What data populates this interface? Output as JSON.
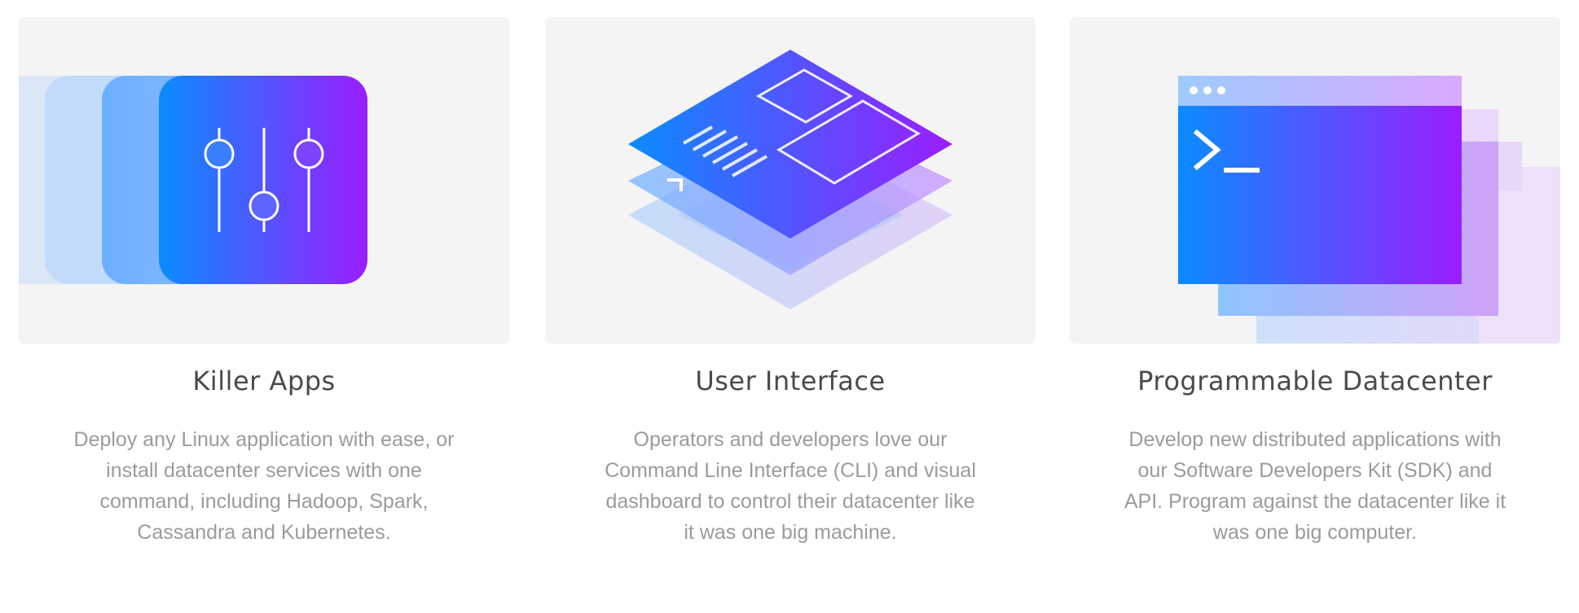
{
  "features": [
    {
      "title": "Killer Apps",
      "icon": "sliders-icon",
      "description": [
        "Deploy any Linux application with ease, or",
        "install datacenter services with one",
        "command, including Hadoop, Spark,",
        "Cassandra and Kubernetes."
      ]
    },
    {
      "title": "User Interface",
      "icon": "layered-dashboard-icon",
      "description": [
        "Operators and developers love our",
        "Command Line Interface (CLI) and visual",
        "dashboard to control their datacenter like",
        "it was one big machine."
      ]
    },
    {
      "title": "Programmable Datacenter",
      "icon": "terminal-window-icon",
      "description": [
        "Develop new distributed applications with",
        "our Software Developers Kit (SDK) and",
        "API. Program against the datacenter like it",
        "was one big computer."
      ]
    }
  ],
  "colors": {
    "gradient_start": "#0a8cff",
    "gradient_end": "#9b1dff",
    "card_background": "#f4f4f4",
    "title_text": "#4a4a4a",
    "body_text": "#9b9b9b"
  }
}
